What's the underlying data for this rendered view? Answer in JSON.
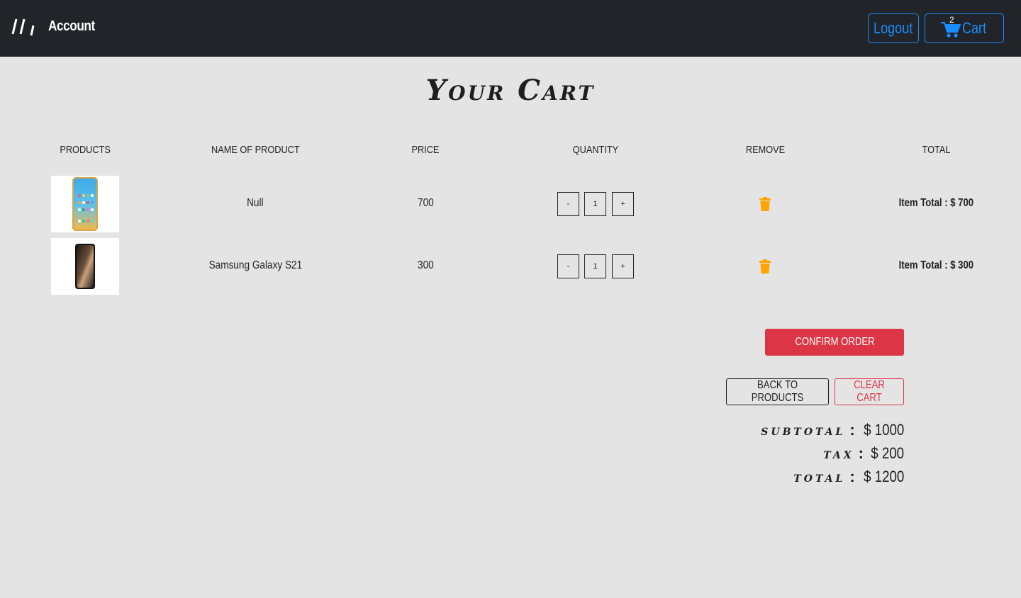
{
  "navbar": {
    "brand_icon": "slashes-logo-icon",
    "account_label": "Account",
    "logout_label": "Logout",
    "cart_label": "Cart",
    "cart_count": "2",
    "accent_color": "#1a8cff",
    "background_color": "#212428"
  },
  "page": {
    "title": "Your Cart"
  },
  "table": {
    "headers": [
      "PRODUCTS",
      "NAME OF PRODUCT",
      "PRICE",
      "QUANTITY",
      "REMOVE",
      "TOTAL"
    ],
    "rows": [
      {
        "image_icon": "smartphone-colorful-screen-image",
        "name": "Null",
        "price": "700",
        "decrement_label": "-",
        "quantity": "1",
        "increment_label": "+",
        "remove_icon": "trash-icon",
        "item_total": "Item Total : $ 700"
      },
      {
        "image_icon": "smartphone-dark-screen-image",
        "name": "Samsung Galaxy S21",
        "price": "300",
        "decrement_label": "-",
        "quantity": "1",
        "increment_label": "+",
        "remove_icon": "trash-icon",
        "item_total": "Item Total : $ 300"
      }
    ]
  },
  "actions": {
    "confirm_label": "CONFIRM ORDER",
    "back_label": "BACK TO PRODUCTS",
    "clear_label": "CLEAR CART",
    "danger_color": "#dc3545",
    "remove_icon_color": "#ffa500"
  },
  "summary": {
    "subtotal_label": "subtotal",
    "subtotal_value": "$ 1000",
    "tax_label": "tax",
    "tax_value": "$ 200",
    "total_label": "total",
    "total_value": "$ 1200",
    "separator": ":"
  }
}
